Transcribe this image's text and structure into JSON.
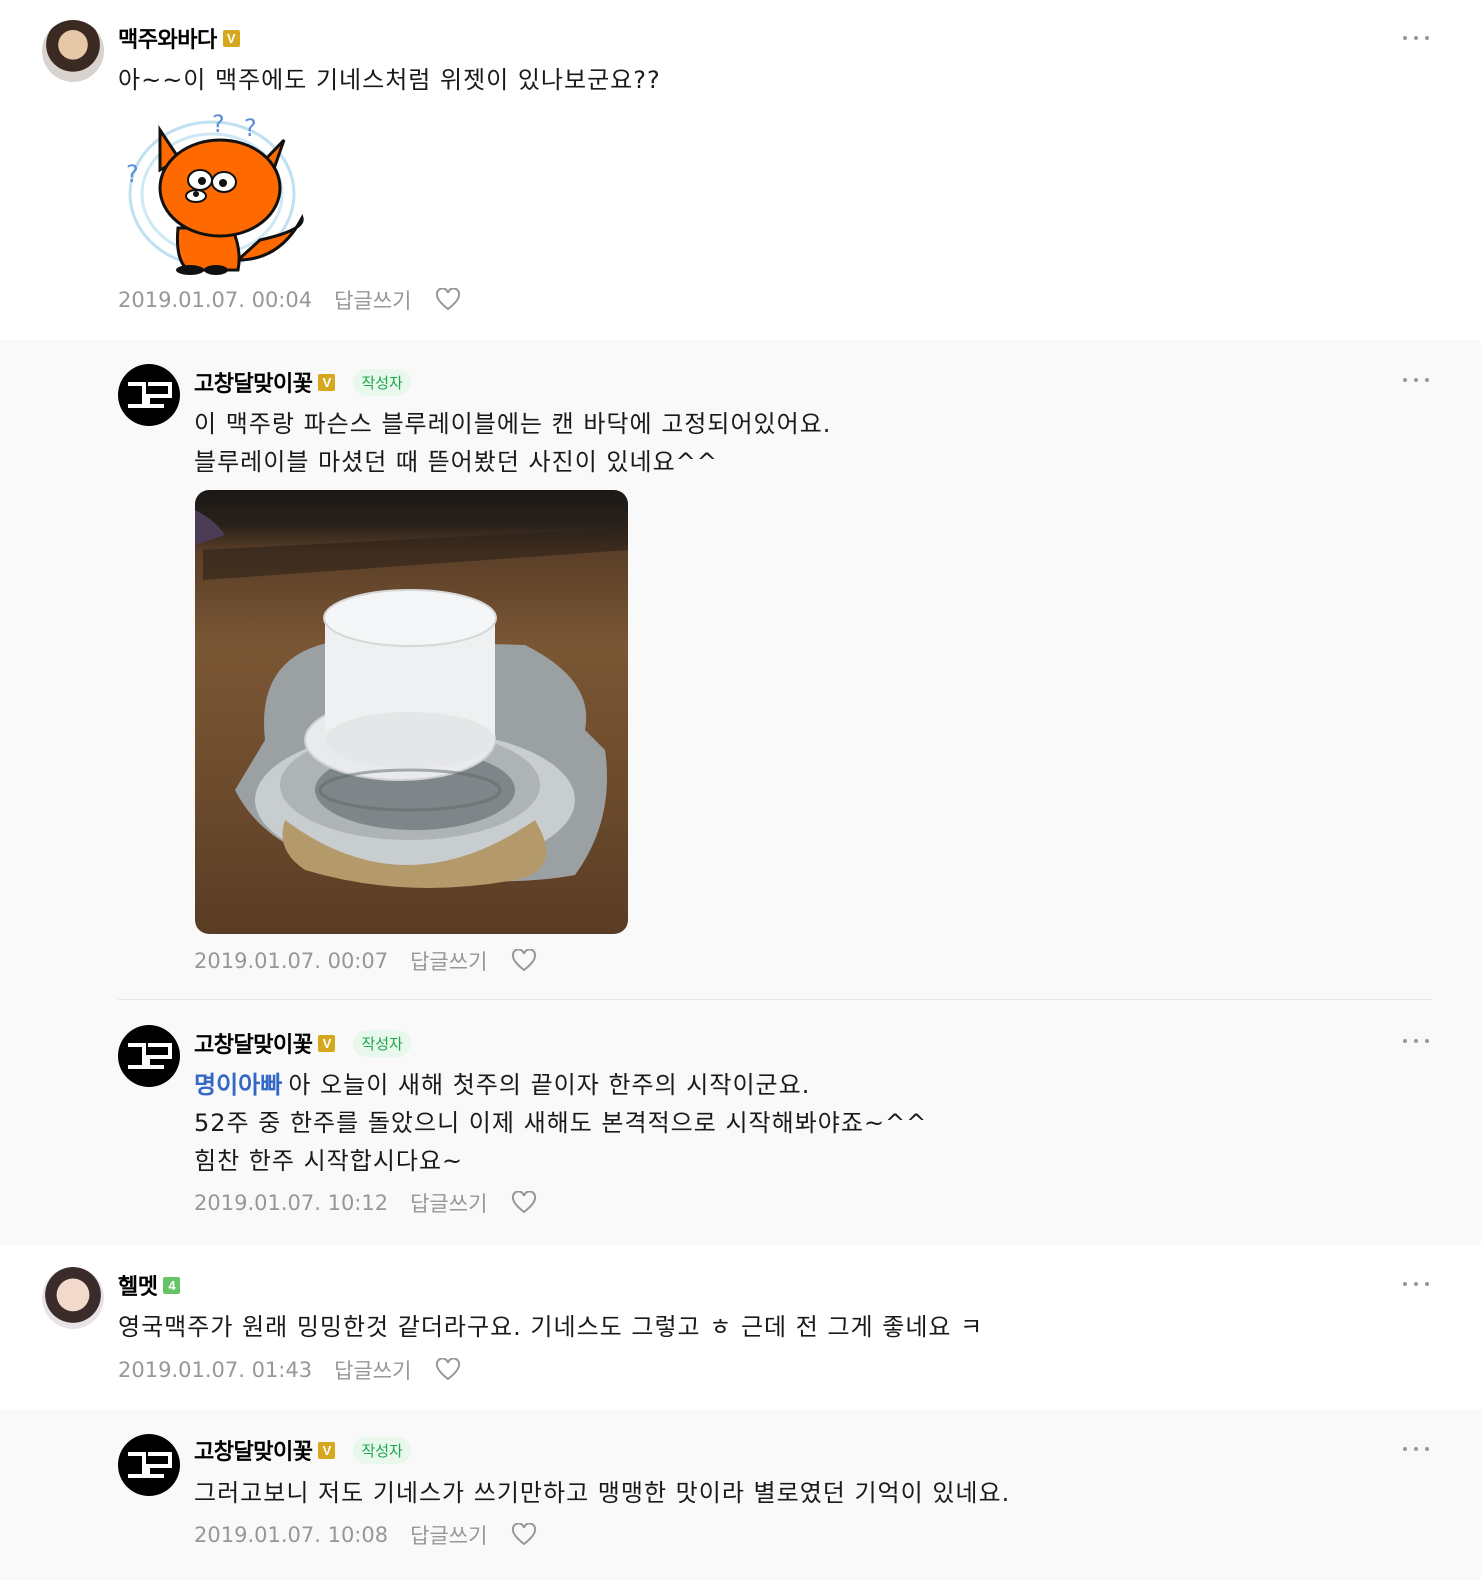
{
  "comments": [
    {
      "nickname": "맥주와바다",
      "level_badge": "V",
      "text": "아~~이 맥주에도 기네스처럼 위젯이 있나보군요??",
      "date": "2019.01.07. 00:04",
      "reply_label": "답글쓰기"
    },
    {
      "nickname": "고창달맞이꽃",
      "level_badge": "V",
      "author_badge": "작성자",
      "lines": [
        "이 맥주랑 파슨스 블루레이블에는 캔 바닥에 고정되어있어요.",
        "블루레이블 마셨던 때 뜯어봤던 사진이 있네요^^"
      ],
      "date": "2019.01.07. 00:07",
      "reply_label": "답글쓰기"
    },
    {
      "nickname": "고창달맞이꽃",
      "level_badge": "V",
      "author_badge": "작성자",
      "mention": "명이아빠",
      "lines": [
        "아 오늘이 새해 첫주의 끝이자 한주의 시작이군요.",
        "52주 중 한주를 돌았으니 이제 새해도 본격적으로 시작해봐야죠~^^",
        "힘찬 한주 시작합시다요~"
      ],
      "date": "2019.01.07. 10:12",
      "reply_label": "답글쓰기"
    },
    {
      "nickname": "헬멧",
      "level_badge": "4",
      "text": "영국맥주가 원래 밍밍한것 같더라구요. 기네스도 그렇고 ㅎ 근데 전 그게 좋네요 ㅋ",
      "date": "2019.01.07. 01:43",
      "reply_label": "답글쓰기"
    },
    {
      "nickname": "고창달맞이꽃",
      "level_badge": "V",
      "author_badge": "작성자",
      "text": "그러고보니 저도 기네스가 쓰기만하고 맹맹한 맛이라 별로였던 기억이 있네요.",
      "date": "2019.01.07. 10:08",
      "reply_label": "답글쓰기"
    }
  ],
  "colors": {
    "mention": "#3468c7",
    "author_badge_text": "#1ca84a",
    "author_badge_bg": "#e9f8ec",
    "level_gold": "#d6a81e",
    "level_green": "#65c566",
    "reply_bg": "#f9f9f9",
    "meta_gray": "#979797"
  },
  "icons": [
    "more-options-icon",
    "heart-icon",
    "level-badge-icon",
    "fox-sticker",
    "cafe-logo"
  ]
}
